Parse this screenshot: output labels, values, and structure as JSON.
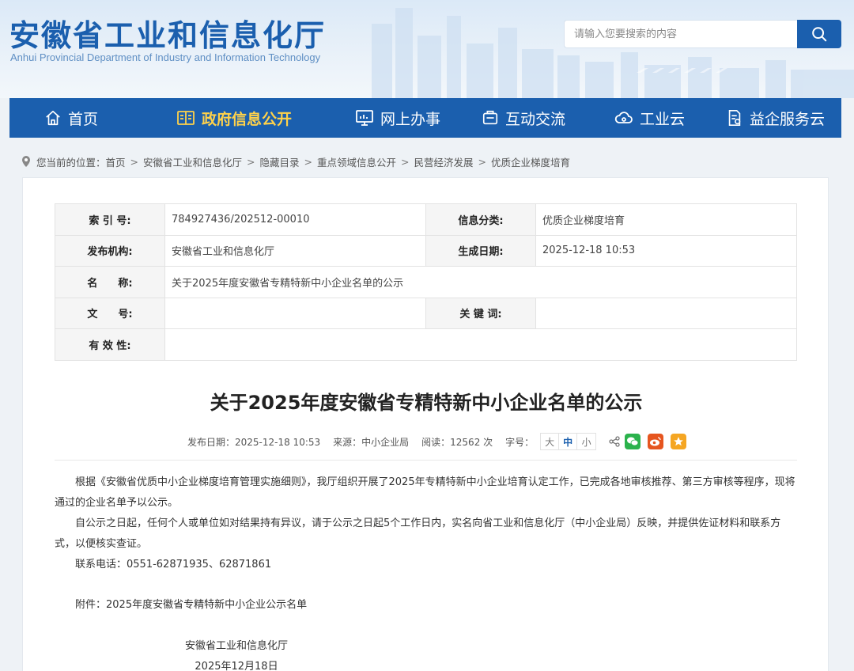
{
  "header": {
    "title": "安徽省工业和信息化厅",
    "subtitle": "Anhui Provincial Department of Industry and Information Technology",
    "search_placeholder": "请输入您要搜索的内容",
    "brand_color": "#1b5fae",
    "search_icon": "search-icon"
  },
  "nav": {
    "items": [
      {
        "label": "首页",
        "icon": "home-icon"
      },
      {
        "label": "政府信息公开",
        "icon": "book-icon",
        "active": true
      },
      {
        "label": "网上办事",
        "icon": "monitor-icon"
      },
      {
        "label": "互动交流",
        "icon": "chat-box-icon"
      },
      {
        "label": "工业云",
        "icon": "cloud-icon"
      },
      {
        "label": "益企服务云",
        "icon": "document-service-icon"
      }
    ],
    "active_color": "#ffd24a"
  },
  "breadcrumb": {
    "prefix": "您当前的位置：",
    "items": [
      "首页",
      "安徽省工业和信息化厅",
      "隐藏目录",
      "重点领域信息公开",
      "民营经济发展",
      "优质企业梯度培育"
    ],
    "separator": ">"
  },
  "meta": {
    "index_label": "索 引 号:",
    "index_value": "784927436/202512-00010",
    "category_label": "信息分类:",
    "category_value": "优质企业梯度培育",
    "publisher_label": "发布机构:",
    "publisher_value": "安徽省工业和信息化厅",
    "created_label": "生成日期:",
    "created_value": "2025-12-18 10:53",
    "name_label": "名　　称:",
    "name_value": "关于2025年度安徽省专精特新中小企业名单的公示",
    "docno_label": "文　　号:",
    "docno_value": "",
    "keywords_label": "关 键 词:",
    "keywords_value": "",
    "validity_label": "有 效 性:",
    "validity_value": ""
  },
  "article": {
    "title": "关于2025年度安徽省专精特新中小企业名单的公示",
    "date_text": "发布日期：2025-12-18 10:53",
    "source_text": "来源：中小企业局",
    "reads_text": "阅读：12562 次",
    "fontsize_label": "字号：",
    "font_sizes": [
      "大",
      "中",
      "小"
    ],
    "paragraphs": [
      "根据《安徽省优质中小企业梯度培育管理实施细则》，我厅组织开展了2025年专精特新中小企业培育认定工作，已完成各地审核推荐、第三方审核等程序，现将通过的企业名单予以公示。",
      "自公示之日起，任何个人或单位如对结果持有异议，请于公示之日起5个工作日内，实名向省工业和信息化厅（中小企业局）反映，并提供佐证材料和联系方式，以便核实查证。",
      "联系电话：0551-62871935、62871861"
    ],
    "attachment": "附件：2025年度安徽省专精特新中小企业公示名单",
    "signature": "安徽省工业和信息化厅",
    "sign_date": "2025年12月18日"
  },
  "share_icons": [
    "share-icon",
    "wechat-icon",
    "weibo-icon",
    "favorite-star-icon"
  ],
  "colors": {
    "wechat": "#2bb24c",
    "weibo": "#e6551f",
    "favorite": "#f5a623"
  }
}
